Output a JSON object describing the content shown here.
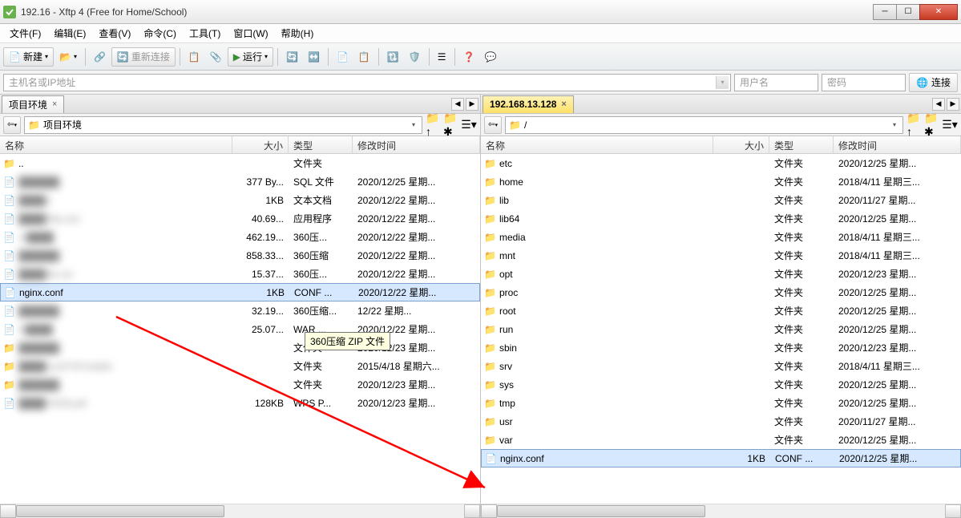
{
  "title": "192.16            - Xftp 4 (Free for Home/School)",
  "menu": [
    "文件(F)",
    "编辑(E)",
    "查看(V)",
    "命令(C)",
    "工具(T)",
    "窗口(W)",
    "帮助(H)"
  ],
  "toolbar": {
    "new": "新建",
    "reconnect": "重新连接",
    "run": "运行"
  },
  "addr": {
    "host_placeholder": "主机名或IP地址",
    "user_placeholder": "用户名",
    "pass_placeholder": "密码",
    "connect": "连接"
  },
  "left": {
    "tab": "项目环境",
    "path": "项目环境",
    "columns": {
      "name": "名称",
      "size": "大小",
      "type": "类型",
      "date": "修改时间"
    },
    "rows": [
      {
        "icon": "folder",
        "name": "..",
        "size": "",
        "type": "文件夹",
        "date": "",
        "blur": false
      },
      {
        "icon": "file",
        "name": "██████",
        "size": "377 By...",
        "type": "SQL 文件",
        "date": "2020/12/25 星期...",
        "blur": true
      },
      {
        "icon": "file",
        "name": "████.t",
        "size": "1KB",
        "type": "文本文档",
        "date": "2020/12/22 星期...",
        "blur": true
      },
      {
        "icon": "file",
        "name": "████04p.exe",
        "size": "40.69...",
        "type": "应用程序",
        "date": "2020/12/22 星期...",
        "blur": true
      },
      {
        "icon": "file",
        "name": "vr████",
        "size": "462.19...",
        "type": "360压...",
        "date": "2020/12/22 星期...",
        "blur": true
      },
      {
        "icon": "file",
        "name": "██████",
        "size": "858.33...",
        "type": "360压缩",
        "date": "2020/12/22 星期...",
        "blur": true
      },
      {
        "icon": "file",
        "name": "████ble.rar",
        "size": "15.37...",
        "type": "360压...",
        "date": "2020/12/22 星期...",
        "blur": true
      },
      {
        "icon": "file",
        "name": "nginx.conf",
        "size": "1KB",
        "type": "CONF ...",
        "date": "2020/12/22 星期...",
        "blur": false,
        "selected": true
      },
      {
        "icon": "file",
        "name": "██████",
        "size": "32.19...",
        "type": "360压缩...",
        "date": "12/22 星期...",
        "blur": true
      },
      {
        "icon": "file",
        "name": "N████",
        "size": "25.07...",
        "type": "WAR ...",
        "date": "2020/12/22 星期...",
        "blur": true
      },
      {
        "icon": "folder",
        "name": "██████",
        "size": "",
        "type": "文件夹",
        "date": "2020/12/23 星期...",
        "blur": true
      },
      {
        "icon": "folder",
        "name": "████cureFXPortable",
        "size": "",
        "type": "文件夹",
        "date": "2015/4/18 星期六...",
        "blur": true
      },
      {
        "icon": "folder",
        "name": "██████",
        "size": "",
        "type": "文件夹",
        "date": "2020/12/23 星期...",
        "blur": true
      },
      {
        "icon": "file",
        "name": "████-0428.pdf",
        "size": "128KB",
        "type": "WPS P...",
        "date": "2020/12/23 星期...",
        "blur": true
      }
    ]
  },
  "right": {
    "tab": "192.168.13.128",
    "path": "/",
    "columns": {
      "name": "名称",
      "size": "大小",
      "type": "类型",
      "date": "修改时间"
    },
    "rows": [
      {
        "icon": "folder",
        "name": "etc",
        "size": "",
        "type": "文件夹",
        "date": "2020/12/25 星期..."
      },
      {
        "icon": "folder",
        "name": "home",
        "size": "",
        "type": "文件夹",
        "date": "2018/4/11 星期三..."
      },
      {
        "icon": "folder",
        "name": "lib",
        "size": "",
        "type": "文件夹",
        "date": "2020/11/27 星期..."
      },
      {
        "icon": "folder",
        "name": "lib64",
        "size": "",
        "type": "文件夹",
        "date": "2020/12/25 星期..."
      },
      {
        "icon": "folder",
        "name": "media",
        "size": "",
        "type": "文件夹",
        "date": "2018/4/11 星期三..."
      },
      {
        "icon": "folder",
        "name": "mnt",
        "size": "",
        "type": "文件夹",
        "date": "2018/4/11 星期三..."
      },
      {
        "icon": "folder",
        "name": "opt",
        "size": "",
        "type": "文件夹",
        "date": "2020/12/23 星期..."
      },
      {
        "icon": "folder",
        "name": "proc",
        "size": "",
        "type": "文件夹",
        "date": "2020/12/25 星期..."
      },
      {
        "icon": "folder",
        "name": "root",
        "size": "",
        "type": "文件夹",
        "date": "2020/12/25 星期..."
      },
      {
        "icon": "folder",
        "name": "run",
        "size": "",
        "type": "文件夹",
        "date": "2020/12/25 星期..."
      },
      {
        "icon": "folder",
        "name": "sbin",
        "size": "",
        "type": "文件夹",
        "date": "2020/12/23 星期..."
      },
      {
        "icon": "folder",
        "name": "srv",
        "size": "",
        "type": "文件夹",
        "date": "2018/4/11 星期三..."
      },
      {
        "icon": "folder",
        "name": "sys",
        "size": "",
        "type": "文件夹",
        "date": "2020/12/25 星期..."
      },
      {
        "icon": "folder",
        "name": "tmp",
        "size": "",
        "type": "文件夹",
        "date": "2020/12/25 星期..."
      },
      {
        "icon": "folder",
        "name": "usr",
        "size": "",
        "type": "文件夹",
        "date": "2020/11/27 星期..."
      },
      {
        "icon": "folder",
        "name": "var",
        "size": "",
        "type": "文件夹",
        "date": "2020/12/25 星期..."
      },
      {
        "icon": "file",
        "name": "nginx.conf",
        "size": "1KB",
        "type": "CONF ...",
        "date": "2020/12/25 星期...",
        "selected": true
      }
    ]
  },
  "tooltip": "360压缩 ZIP 文件"
}
